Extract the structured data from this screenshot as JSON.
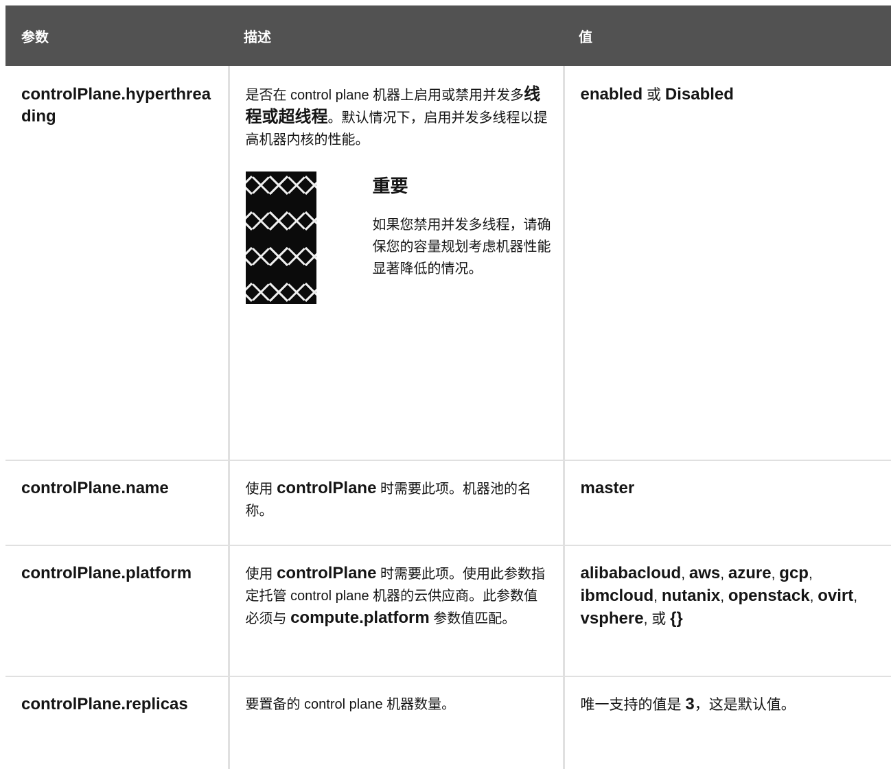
{
  "header": {
    "col_param": "参数",
    "col_desc": "描述",
    "col_value": "值"
  },
  "rows": [
    {
      "param": "controlPlane.hyperthreading",
      "desc_parts": [
        "是否在 control plane 机器上启用或禁用并发多",
        "线程或超线程",
        "。默认情况下，启用并发多线程以提高机器内核的性能。"
      ],
      "admonition": {
        "title": "重要",
        "text": "如果您禁用并发多线程，请确保您的容量规划考虑机器性能显著降低的情况。"
      },
      "value_parts": [
        "enabled",
        " 或 ",
        "Disabled"
      ]
    },
    {
      "param": "controlPlane.name",
      "desc_parts": [
        "使用 ",
        "controlPlane",
        " 时需要此项。机器池的名称。"
      ],
      "value_parts": [
        "master"
      ]
    },
    {
      "param": "controlPlane.platform",
      "desc_parts": [
        "使用 ",
        "controlPlane",
        " 时需要此项。使用此参数指定托管 control plane 机器的云供应商。此参数值必须与 ",
        "compute.platform",
        " 参数值匹配。"
      ],
      "value_parts": [
        "alibabacloud",
        ", ",
        "aws",
        ", ",
        "azure",
        ", ",
        "gcp",
        ", ",
        "ibmcloud",
        ", ",
        "nutanix",
        ", ",
        "openstack",
        ", ",
        "ovirt",
        ", ",
        "vsphere",
        ", 或 ",
        "{}"
      ]
    },
    {
      "param": "controlPlane.replicas",
      "desc_parts": [
        "要置备的 control plane 机器数量。"
      ],
      "value_parts": [
        "唯一支持的值是 ",
        "3",
        "，这是默认值。"
      ]
    }
  ]
}
